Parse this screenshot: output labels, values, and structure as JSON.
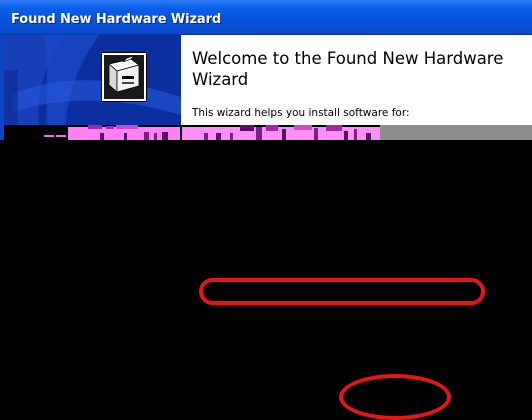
{
  "window": {
    "title": "Found New Hardware Wizard"
  },
  "wizard": {
    "heading": "Welcome to the Found New Hardware Wizard",
    "intro_text": "This wizard helps you install software for:",
    "icon": "hardware-box-icon"
  },
  "colors": {
    "titlebar": "#0554e0",
    "left_panel": "#0b2f9e",
    "content_bg": "#ffffff",
    "screen_bg": "#000000",
    "glitch_pink": "#ff66ff",
    "glitch_gray": "#8c8c8c",
    "annotation": "#e41616"
  }
}
